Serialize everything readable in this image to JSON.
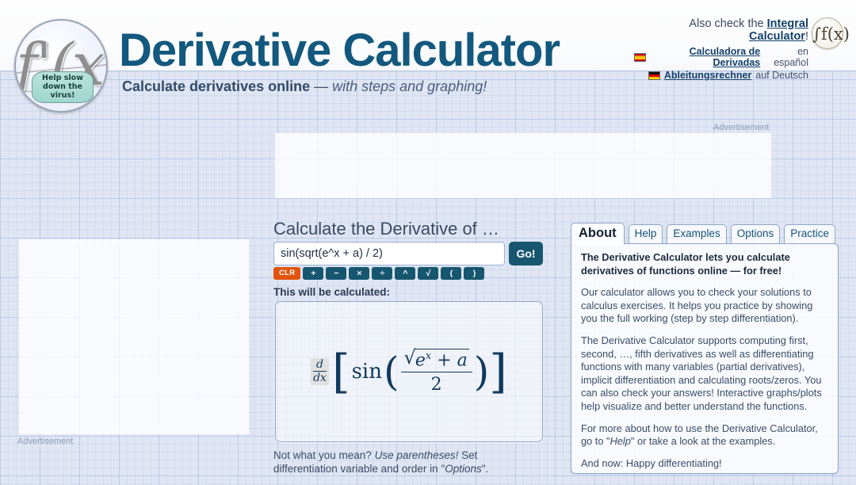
{
  "header": {
    "title": "Derivative Calculator",
    "subtitle_bold": "Calculate derivatives online",
    "subtitle_dash": " — ",
    "subtitle_italic": "with steps and graphing!",
    "logo": {
      "symbol": "f'(x)",
      "mask_text": "Help slow down the virus!",
      "mask_line1": "Help slow",
      "mask_line2": "down the",
      "mask_line3": "virus!"
    },
    "also_check_prefix": "Also check the ",
    "also_check_link": "Integral Calculator",
    "also_check_suffix": "!",
    "languages": [
      {
        "flag": "flag-es",
        "link": "Calculadora de Derivadas",
        "suffix": " en español"
      },
      {
        "flag": "flag-de",
        "link": "Ableitungsrechner",
        "suffix": " auf Deutsch"
      }
    ],
    "integral_logo": "∫f(x)"
  },
  "ads": {
    "top_label": "Advertisement",
    "left_label": "Advertisement"
  },
  "calculator": {
    "heading": "Calculate the Derivative of …",
    "input_value": "sin(sqrt(e^x + a) / 2)",
    "input_placeholder": "",
    "go_label": "Go!",
    "keys": [
      "CLR",
      "+",
      "−",
      "×",
      "÷",
      "^",
      "√",
      "(",
      ")"
    ],
    "will_be_calculated_label": "This will be calculated:",
    "formula": {
      "operator_num": "d",
      "operator_den": "dx",
      "bracket_open": "[",
      "bracket_close": "]",
      "function": "sin",
      "paren_open": "(",
      "paren_close": ")",
      "radical": "√",
      "numerator": "e^x + a",
      "numerator_base": "e",
      "numerator_exp": "x",
      "numerator_rest": " + a",
      "denominator": "2",
      "plain": "d/dx [ sin( √(e^x + a) / 2 ) ]"
    },
    "footer_note_1": "Not what you mean? ",
    "footer_note_italic": "Use parentheses!",
    "footer_note_2": " Set differentiation variable and order in \"",
    "footer_note_italic2": "Options",
    "footer_note_3": "\"."
  },
  "panel": {
    "tabs": [
      {
        "label": "About",
        "active": true
      },
      {
        "label": "Help",
        "active": false
      },
      {
        "label": "Examples",
        "active": false
      },
      {
        "label": "Options",
        "active": false
      },
      {
        "label": "Practice",
        "active": false
      }
    ],
    "about": {
      "lead": "The Derivative Calculator lets you calculate derivatives of functions online — for free!",
      "p1": "Our calculator allows you to check your solutions to calculus exercises. It helps you practice by showing you the full working (step by step differentiation).",
      "p2": "The Derivative Calculator supports computing first, second, …, fifth derivatives as well as differentiating functions with many variables (partial derivatives), implicit differentiation and calculating roots/zeros. You can also check your answers! Interactive graphs/plots help visualize and better understand the functions.",
      "p3_a": "For more about how to use the Derivative Calculator, go to \"",
      "p3_i": "Help",
      "p3_b": "\" or take a look at the examples.",
      "p4": "And now: Happy differentiating!"
    }
  },
  "colors": {
    "brand": "#13587e",
    "button": "#17566f",
    "clr": "#e2540e",
    "background": "#dfe5f3"
  }
}
